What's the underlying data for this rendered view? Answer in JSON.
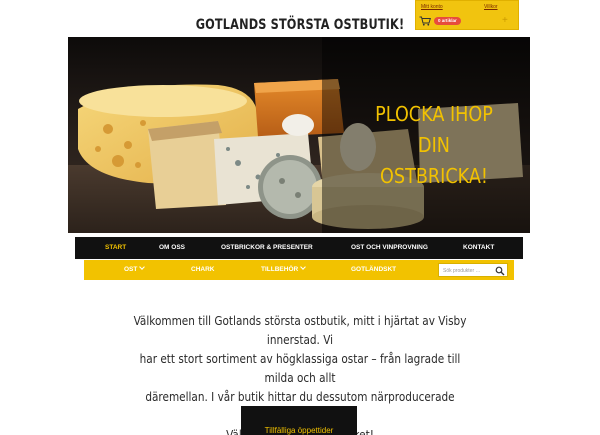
{
  "header": {
    "account": {
      "my_account": "Mitt konto",
      "terms": "Villkor",
      "cart_count": "0 artiklar"
    },
    "site_title": "GOTLANDS STÖRSTA OSTBUTIK!"
  },
  "hero": {
    "line1": "PLOCKA IHOP DIN",
    "line2": "OSTBRICKA!"
  },
  "main_nav": {
    "items": [
      {
        "label": "START",
        "active": true
      },
      {
        "label": "OM OSS"
      },
      {
        "label": "OSTBRICKOR & PRESENTER"
      },
      {
        "label": "OST OCH VINPROVNING"
      },
      {
        "label": "KONTAKT"
      }
    ]
  },
  "sub_nav": {
    "items": [
      {
        "label": "OST",
        "has_dropdown": true
      },
      {
        "label": "CHARK"
      },
      {
        "label": "TILLBEHÖR",
        "has_dropdown": true
      },
      {
        "label": "GOTLÄNDSKT"
      }
    ],
    "search": {
      "placeholder": "Sök produkter …"
    }
  },
  "welcome": {
    "line1": "Välkommen till Gotlands största ostbutik, mitt i hjärtat av Visby innerstad. Vi",
    "line2": "har ett stort sortiment av högklassiga ostar – från lagrade till milda och allt",
    "line3": "däremellan. I vår butik hittar du dessutom närproducerade produkter.",
    "line4": "Välkommen till himmelriket!"
  },
  "hours_box": {
    "label": "Tillfälliga öppettider"
  },
  "colors": {
    "accent": "#f2c200",
    "nav_bg": "#111111",
    "badge": "#e74c3c"
  }
}
